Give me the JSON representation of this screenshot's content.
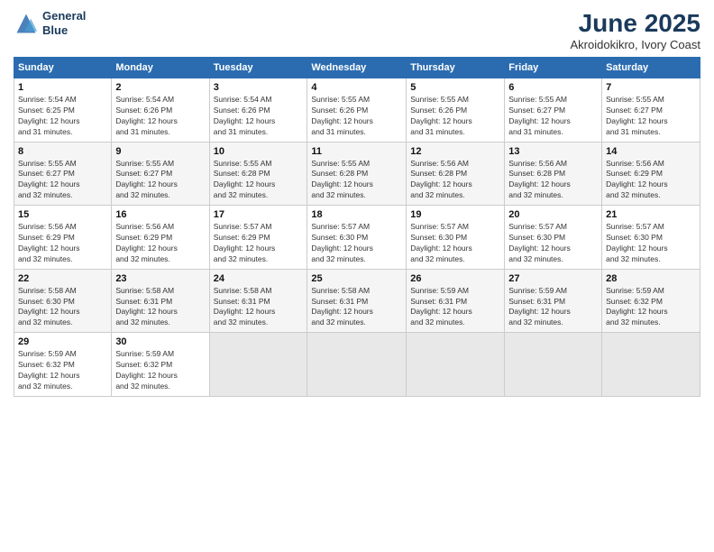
{
  "header": {
    "logo_line1": "General",
    "logo_line2": "Blue",
    "title": "June 2025",
    "location": "Akroidokikro, Ivory Coast"
  },
  "weekdays": [
    "Sunday",
    "Monday",
    "Tuesday",
    "Wednesday",
    "Thursday",
    "Friday",
    "Saturday"
  ],
  "weeks": [
    [
      {
        "day": "1",
        "info": "Sunrise: 5:54 AM\nSunset: 6:25 PM\nDaylight: 12 hours\nand 31 minutes."
      },
      {
        "day": "2",
        "info": "Sunrise: 5:54 AM\nSunset: 6:26 PM\nDaylight: 12 hours\nand 31 minutes."
      },
      {
        "day": "3",
        "info": "Sunrise: 5:54 AM\nSunset: 6:26 PM\nDaylight: 12 hours\nand 31 minutes."
      },
      {
        "day": "4",
        "info": "Sunrise: 5:55 AM\nSunset: 6:26 PM\nDaylight: 12 hours\nand 31 minutes."
      },
      {
        "day": "5",
        "info": "Sunrise: 5:55 AM\nSunset: 6:26 PM\nDaylight: 12 hours\nand 31 minutes."
      },
      {
        "day": "6",
        "info": "Sunrise: 5:55 AM\nSunset: 6:27 PM\nDaylight: 12 hours\nand 31 minutes."
      },
      {
        "day": "7",
        "info": "Sunrise: 5:55 AM\nSunset: 6:27 PM\nDaylight: 12 hours\nand 31 minutes."
      }
    ],
    [
      {
        "day": "8",
        "info": "Sunrise: 5:55 AM\nSunset: 6:27 PM\nDaylight: 12 hours\nand 32 minutes."
      },
      {
        "day": "9",
        "info": "Sunrise: 5:55 AM\nSunset: 6:27 PM\nDaylight: 12 hours\nand 32 minutes."
      },
      {
        "day": "10",
        "info": "Sunrise: 5:55 AM\nSunset: 6:28 PM\nDaylight: 12 hours\nand 32 minutes."
      },
      {
        "day": "11",
        "info": "Sunrise: 5:55 AM\nSunset: 6:28 PM\nDaylight: 12 hours\nand 32 minutes."
      },
      {
        "day": "12",
        "info": "Sunrise: 5:56 AM\nSunset: 6:28 PM\nDaylight: 12 hours\nand 32 minutes."
      },
      {
        "day": "13",
        "info": "Sunrise: 5:56 AM\nSunset: 6:28 PM\nDaylight: 12 hours\nand 32 minutes."
      },
      {
        "day": "14",
        "info": "Sunrise: 5:56 AM\nSunset: 6:29 PM\nDaylight: 12 hours\nand 32 minutes."
      }
    ],
    [
      {
        "day": "15",
        "info": "Sunrise: 5:56 AM\nSunset: 6:29 PM\nDaylight: 12 hours\nand 32 minutes."
      },
      {
        "day": "16",
        "info": "Sunrise: 5:56 AM\nSunset: 6:29 PM\nDaylight: 12 hours\nand 32 minutes."
      },
      {
        "day": "17",
        "info": "Sunrise: 5:57 AM\nSunset: 6:29 PM\nDaylight: 12 hours\nand 32 minutes."
      },
      {
        "day": "18",
        "info": "Sunrise: 5:57 AM\nSunset: 6:30 PM\nDaylight: 12 hours\nand 32 minutes."
      },
      {
        "day": "19",
        "info": "Sunrise: 5:57 AM\nSunset: 6:30 PM\nDaylight: 12 hours\nand 32 minutes."
      },
      {
        "day": "20",
        "info": "Sunrise: 5:57 AM\nSunset: 6:30 PM\nDaylight: 12 hours\nand 32 minutes."
      },
      {
        "day": "21",
        "info": "Sunrise: 5:57 AM\nSunset: 6:30 PM\nDaylight: 12 hours\nand 32 minutes."
      }
    ],
    [
      {
        "day": "22",
        "info": "Sunrise: 5:58 AM\nSunset: 6:30 PM\nDaylight: 12 hours\nand 32 minutes."
      },
      {
        "day": "23",
        "info": "Sunrise: 5:58 AM\nSunset: 6:31 PM\nDaylight: 12 hours\nand 32 minutes."
      },
      {
        "day": "24",
        "info": "Sunrise: 5:58 AM\nSunset: 6:31 PM\nDaylight: 12 hours\nand 32 minutes."
      },
      {
        "day": "25",
        "info": "Sunrise: 5:58 AM\nSunset: 6:31 PM\nDaylight: 12 hours\nand 32 minutes."
      },
      {
        "day": "26",
        "info": "Sunrise: 5:59 AM\nSunset: 6:31 PM\nDaylight: 12 hours\nand 32 minutes."
      },
      {
        "day": "27",
        "info": "Sunrise: 5:59 AM\nSunset: 6:31 PM\nDaylight: 12 hours\nand 32 minutes."
      },
      {
        "day": "28",
        "info": "Sunrise: 5:59 AM\nSunset: 6:32 PM\nDaylight: 12 hours\nand 32 minutes."
      }
    ],
    [
      {
        "day": "29",
        "info": "Sunrise: 5:59 AM\nSunset: 6:32 PM\nDaylight: 12 hours\nand 32 minutes."
      },
      {
        "day": "30",
        "info": "Sunrise: 5:59 AM\nSunset: 6:32 PM\nDaylight: 12 hours\nand 32 minutes."
      },
      {
        "day": "",
        "info": ""
      },
      {
        "day": "",
        "info": ""
      },
      {
        "day": "",
        "info": ""
      },
      {
        "day": "",
        "info": ""
      },
      {
        "day": "",
        "info": ""
      }
    ]
  ]
}
